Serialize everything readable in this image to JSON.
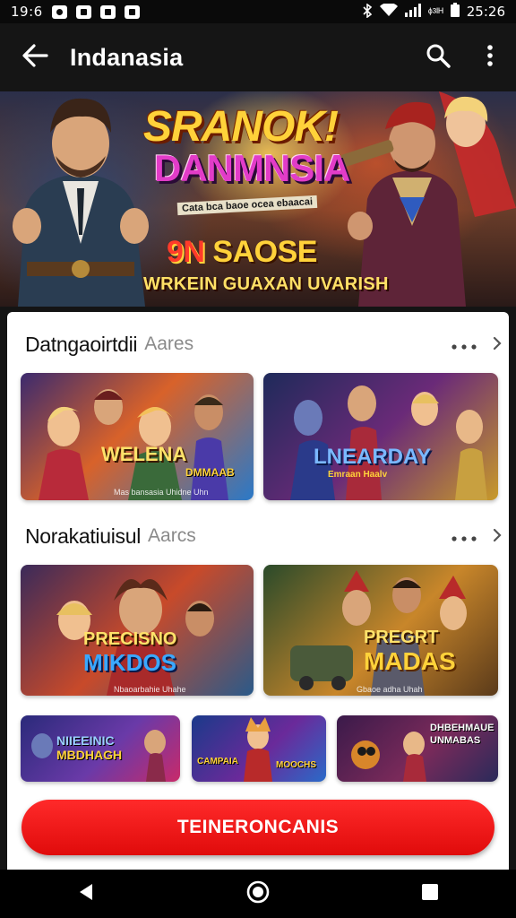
{
  "status_bar": {
    "time": "19:6",
    "clock": "25:26",
    "icons": [
      "notification-icon",
      "notification-icon",
      "notification-icon",
      "notification-icon",
      "bluetooth-icon",
      "wifi-icon",
      "signal-icon",
      "battery-icon"
    ],
    "carrier_text": "ᶲ³ᴵᴴ"
  },
  "app_bar": {
    "title": "Indanasia",
    "back_icon": "arrow-left-icon",
    "search_icon": "search-icon",
    "menu_icon": "more-vert-icon"
  },
  "hero": {
    "title_line1": "SRANOK!",
    "title_line2": "DANMNSIA",
    "subtitle": "Cata bca baoe ocea ebaacai",
    "offer_number": "9N",
    "offer_text": "SAOSE",
    "tagline": "WRKEIN GUAXAN UVARISH"
  },
  "sections": [
    {
      "title": "Datngaoirtdii",
      "subtitle": "Aares",
      "more_icon": "more-horiz-icon",
      "chevron_icon": "chevron-right-icon",
      "cards": [
        {
          "label": "WELENA",
          "label2": "DMMAAB",
          "caption": "Mas bansasia Uhidne Uhn"
        },
        {
          "label": "LNEARDAY",
          "label2": "Emraan Haalv",
          "caption": ""
        }
      ]
    },
    {
      "title": "Norakatiuisul",
      "subtitle": "Aarcs",
      "more_icon": "more-horiz-icon",
      "chevron_icon": "chevron-right-icon",
      "cards": [
        {
          "label": "PRECISNO",
          "label2": "MIKDOS",
          "caption": "Nbaoarbahie Uhahe"
        },
        {
          "label": "PREGRT",
          "label2": "MADAS",
          "caption": "Gbaoe adha Uhah"
        }
      ]
    }
  ],
  "small_cards": [
    {
      "label": "NIIEEINIC",
      "label2": "MBDHAGH"
    },
    {
      "label": "CAMPAIA",
      "label2": "MOOCHS"
    },
    {
      "label": "DHBEHMAUE",
      "label2": "UNMABAS"
    }
  ],
  "cta": {
    "label": "TEINERONCANIS"
  },
  "nav_bar": {
    "back_icon": "triangle-back-icon",
    "home_icon": "circle-home-icon",
    "recents_icon": "square-recents-icon"
  },
  "colors": {
    "accent": "#e60f0f",
    "app_bar": "#151515",
    "panel": "#ffffff"
  }
}
